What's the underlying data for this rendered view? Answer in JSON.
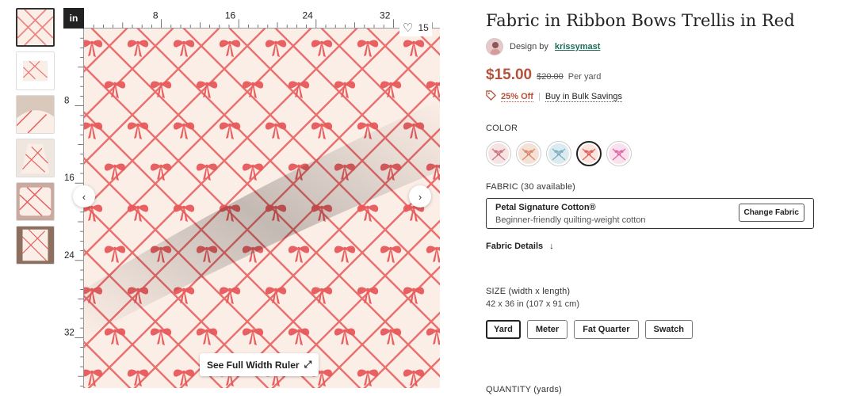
{
  "thumbnails": [
    {
      "name": "thumb-swatch-closeup",
      "active": true
    },
    {
      "name": "thumb-flat-fabric",
      "active": false
    },
    {
      "name": "thumb-draped-fabric",
      "active": false
    },
    {
      "name": "thumb-skirt",
      "active": false
    },
    {
      "name": "thumb-pillow",
      "active": false
    },
    {
      "name": "thumb-blanket",
      "active": false
    }
  ],
  "viewer": {
    "unit": "in",
    "ruler_top_labels": [
      "8",
      "16",
      "24",
      "32"
    ],
    "ruler_left_labels": [
      "8",
      "16",
      "24",
      "32"
    ],
    "favorites_count": "15",
    "prev_icon": "‹",
    "next_icon": "›",
    "full_ruler_label": "See Full Width Ruler",
    "expand_icon": "⤢"
  },
  "product": {
    "title": "Fabric in Ribbon Bows Trellis in Red",
    "designer_prefix": "Design by",
    "designer_name": "krissymast",
    "price": "$15.00",
    "old_price": "$20.00",
    "per_unit": "Per yard",
    "discount": "25% Off",
    "separator": "|",
    "bulk_link": "Buy in Bulk Savings",
    "color_label": "COLOR",
    "colors": [
      {
        "name": "light-pink",
        "bg": "#f7e3e3",
        "fg": "#c97a80",
        "selected": false
      },
      {
        "name": "peach",
        "bg": "#f6e1d6",
        "fg": "#d98b6c",
        "selected": false
      },
      {
        "name": "light-blue",
        "bg": "#dcebef",
        "fg": "#7fb0c2",
        "selected": false
      },
      {
        "name": "red",
        "bg": "#fbe6df",
        "fg": "#e0605d",
        "selected": true
      },
      {
        "name": "bright-pink",
        "bg": "#fbe0ee",
        "fg": "#e06aa8",
        "selected": false
      }
    ],
    "fabric_label": "FABRIC (30 available)",
    "fabric_name": "Petal Signature Cotton®",
    "fabric_desc": "Beginner-friendly quilting-weight cotton",
    "change_fabric": "Change Fabric",
    "details_label": "Fabric Details",
    "details_icon": "↓",
    "size_label": "SIZE (width x length)",
    "size_dims": "42 x 36 in (107 x 91 cm)",
    "sizes": [
      {
        "label": "Yard",
        "selected": true
      },
      {
        "label": "Meter",
        "selected": false
      },
      {
        "label": "Fat Quarter",
        "selected": false
      },
      {
        "label": "Swatch",
        "selected": false
      }
    ],
    "quantity_label": "QUANTITY (yards)"
  },
  "colors": {
    "accent": "#b5523b",
    "link": "#1f6b5a",
    "ribbon": "#e8595a",
    "fabric_bg": "#fbeee6"
  }
}
